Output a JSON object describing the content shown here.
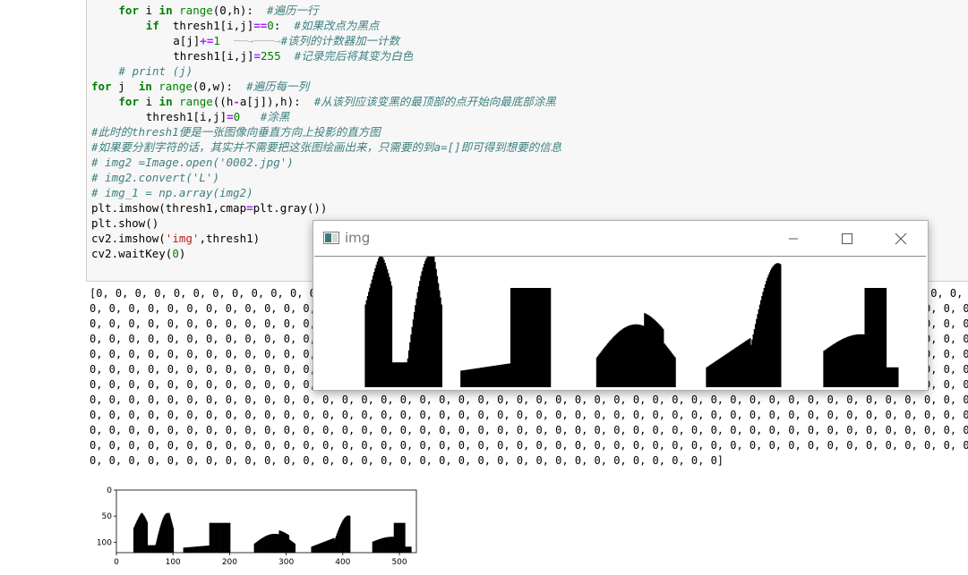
{
  "code_lines": [
    {
      "indent": 4,
      "tokens": [
        [
          "kw",
          "for"
        ],
        [
          "t",
          " i "
        ],
        [
          "kw",
          "in"
        ],
        [
          "t",
          " "
        ],
        [
          "bi",
          "range"
        ],
        [
          "t",
          "(0,h):  "
        ],
        [
          "cm",
          "#遍历一行"
        ]
      ]
    },
    {
      "indent": 8,
      "tokens": [
        [
          "kw",
          "if"
        ],
        [
          "t",
          "  thresh1[i,j]"
        ],
        [
          "op",
          "=="
        ],
        [
          "num",
          "0"
        ],
        [
          "t",
          ":  "
        ],
        [
          "cm",
          "#如果改点为黑点"
        ]
      ]
    },
    {
      "indent": 12,
      "tokens": [
        [
          "t",
          "a[j]"
        ],
        [
          "op",
          "+="
        ],
        [
          "num",
          "1"
        ],
        [
          "arrow",
          "  ──→───→"
        ],
        [
          "cm",
          "#该列的计数器加一计数"
        ]
      ]
    },
    {
      "indent": 12,
      "tokens": [
        [
          "t",
          "thresh1[i,j]"
        ],
        [
          "op",
          "="
        ],
        [
          "num",
          "255"
        ],
        [
          "t",
          "  "
        ],
        [
          "cm",
          "#记录完后将其变为白色"
        ]
      ]
    },
    {
      "indent": 4,
      "tokens": [
        [
          "cm",
          "# print (j)"
        ]
      ]
    },
    {
      "indent": 0,
      "tokens": [
        [
          "kw",
          "for"
        ],
        [
          "t",
          " j  "
        ],
        [
          "kw",
          "in"
        ],
        [
          "t",
          " "
        ],
        [
          "bi",
          "range"
        ],
        [
          "t",
          "(0,w):  "
        ],
        [
          "cm",
          "#遍历每一列"
        ]
      ]
    },
    {
      "indent": 4,
      "tokens": [
        [
          "kw",
          "for"
        ],
        [
          "t",
          " i "
        ],
        [
          "kw",
          "in"
        ],
        [
          "t",
          " "
        ],
        [
          "bi",
          "range"
        ],
        [
          "t",
          "((h"
        ],
        [
          "op",
          "-"
        ],
        [
          "t",
          "a[j]),h):  "
        ],
        [
          "cm",
          "#从该列应该变黑的最顶部的点开始向最底部涂黑"
        ]
      ]
    },
    {
      "indent": 8,
      "tokens": [
        [
          "t",
          "thresh1[i,j]"
        ],
        [
          "op",
          "="
        ],
        [
          "num",
          "0"
        ],
        [
          "t",
          "   "
        ],
        [
          "cm",
          "#涂黑"
        ]
      ]
    },
    {
      "indent": 0,
      "tokens": [
        [
          "cm",
          "#此时的thresh1便是一张图像向垂直方向上投影的直方图"
        ]
      ]
    },
    {
      "indent": 0,
      "tokens": [
        [
          "cm",
          "#如果要分割字符的话，其实并不需要把这张图绘画出来，只需要的到a=[]即可得到想要的信息"
        ]
      ]
    },
    {
      "indent": 0,
      "tokens": [
        [
          "cm",
          "# img2 =Image.open('0002.jpg')"
        ]
      ]
    },
    {
      "indent": 0,
      "tokens": [
        [
          "cm",
          "# img2.convert('L')"
        ]
      ]
    },
    {
      "indent": 0,
      "tokens": [
        [
          "cm",
          "# img_1 = np.array(img2)"
        ]
      ]
    },
    {
      "indent": 0,
      "tokens": [
        [
          "t",
          "plt.imshow(thresh1,cmap"
        ],
        [
          "op",
          "="
        ],
        [
          "t",
          "plt.gray())"
        ]
      ]
    },
    {
      "indent": 0,
      "tokens": [
        [
          "t",
          "plt.show()"
        ]
      ]
    },
    {
      "indent": 0,
      "tokens": [
        [
          "t",
          "cv2.imshow("
        ],
        [
          "str",
          "'img'"
        ],
        [
          "t",
          ",thresh1)"
        ]
      ]
    },
    {
      "indent": 0,
      "tokens": [
        [
          "t",
          "cv2.waitKey("
        ],
        [
          "num",
          "0"
        ],
        [
          "t",
          ")"
        ]
      ]
    }
  ],
  "output": {
    "full_row": "0, 0, 0, 0, 0, 0, 0, 0, 0, 0, 0, 0, 0, 0, 0, 0, 0, 0, 0, 0, 0, 0, 0, 0, 0, 0, 0, 0, 0, 0, 0, 0, 0, 0, 0, 0, 0, 0, 0, 0, 0, 0, 0, 0, 0, 0, 0, 0, 0, 0, 0, 0, 0, 0, 0, 0, 0, 0, 0, 0, 0, 0, 0, 0, 0, 0, 0, 0, 0, 0, 0, 0, 0, 0, 0, 0, 0, 0,",
    "first_row": "[0, 0, 0, 0, 0, 0, 0, 0, 0, 0, 0, 0, 0, 0, 0, 0, 0, 0, 0, 0, 0, 0, 0, 0, 0, 0, 0, 0, 0, 0, 0, 0, 0, 0, 0, 0, 0, 0, 0, 0, 0, 0, 0, 0, 0, 0, 0, 0, 0, 0, 0, 0, 0, 0, 0, 0, 0, 0, 0, 0, 0, 0, 0, 0, 0, 0, 0, 0, 0, 0, 0, 0, 0, 0, 0, 0, 0, 0,",
    "last_row": "0, 0, 0, 0, 0, 0, 0, 0, 0, 0, 0, 0, 0, 0, 0, 0, 0, 0, 0, 0, 0, 0, 0, 0, 0, 0, 0, 0, 0, 0, 0, 0, 0]",
    "row_count": 12
  },
  "window": {
    "title": "img",
    "minimize_icon": "minimize-icon",
    "maximize_icon": "maximize-icon",
    "close_icon": "close-icon"
  },
  "plot": {
    "xticks": [
      "0",
      "100",
      "200",
      "300",
      "400",
      "500"
    ],
    "yticks": [
      "0",
      "50",
      "100"
    ],
    "xlim": [
      0,
      530
    ],
    "ylim": [
      0,
      120
    ]
  },
  "chart_data": {
    "type": "bar",
    "segments": [
      {
        "x_range": [
          30,
          100
        ],
        "note": "U-shaped character"
      },
      {
        "x_range": [
          118,
          200
        ],
        "note": "step-shaped character"
      },
      {
        "x_range": [
          243,
          315
        ],
        "note": "rounded hump"
      },
      {
        "x_range": [
          344,
          412
        ],
        "note": "rising hump"
      },
      {
        "x_range": [
          452,
          520
        ],
        "note": "step with peak"
      }
    ],
    "xlim": [
      0,
      530
    ],
    "ylim": [
      0,
      120
    ]
  }
}
